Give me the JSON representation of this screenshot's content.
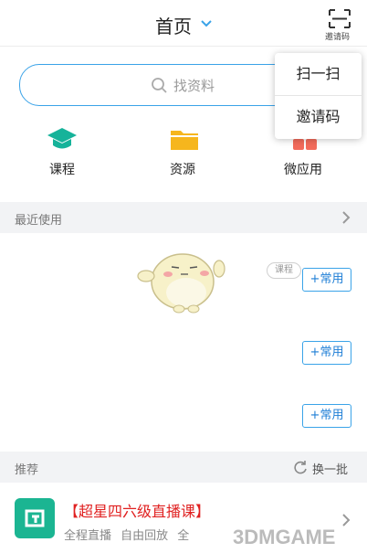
{
  "header": {
    "title": "首页",
    "invite_code_label": "邀请码"
  },
  "search": {
    "placeholder": "找资料"
  },
  "quick_access": [
    {
      "label": "课程",
      "icon": "graduation-cap-icon",
      "color": "#16b39a"
    },
    {
      "label": "资源",
      "icon": "folder-icon",
      "color": "#f6b61d"
    },
    {
      "label": "微应用",
      "icon": "apps-icon",
      "color": "#f26b5b"
    }
  ],
  "recent": {
    "title": "最近使用",
    "course_tag": "课程",
    "add_label": "+常用"
  },
  "recommend": {
    "title": "推荐",
    "refresh_label": "换一批",
    "item_title": "【超星四六级直播课】",
    "item_subtitle": "全程直播  自由回放  全"
  },
  "popup_menu": {
    "items": [
      "扫一扫",
      "邀请码"
    ]
  },
  "watermark": {
    "text": "3DMGAME"
  },
  "colors": {
    "accent": "#3aa3e8",
    "red_title": "#e02020"
  }
}
